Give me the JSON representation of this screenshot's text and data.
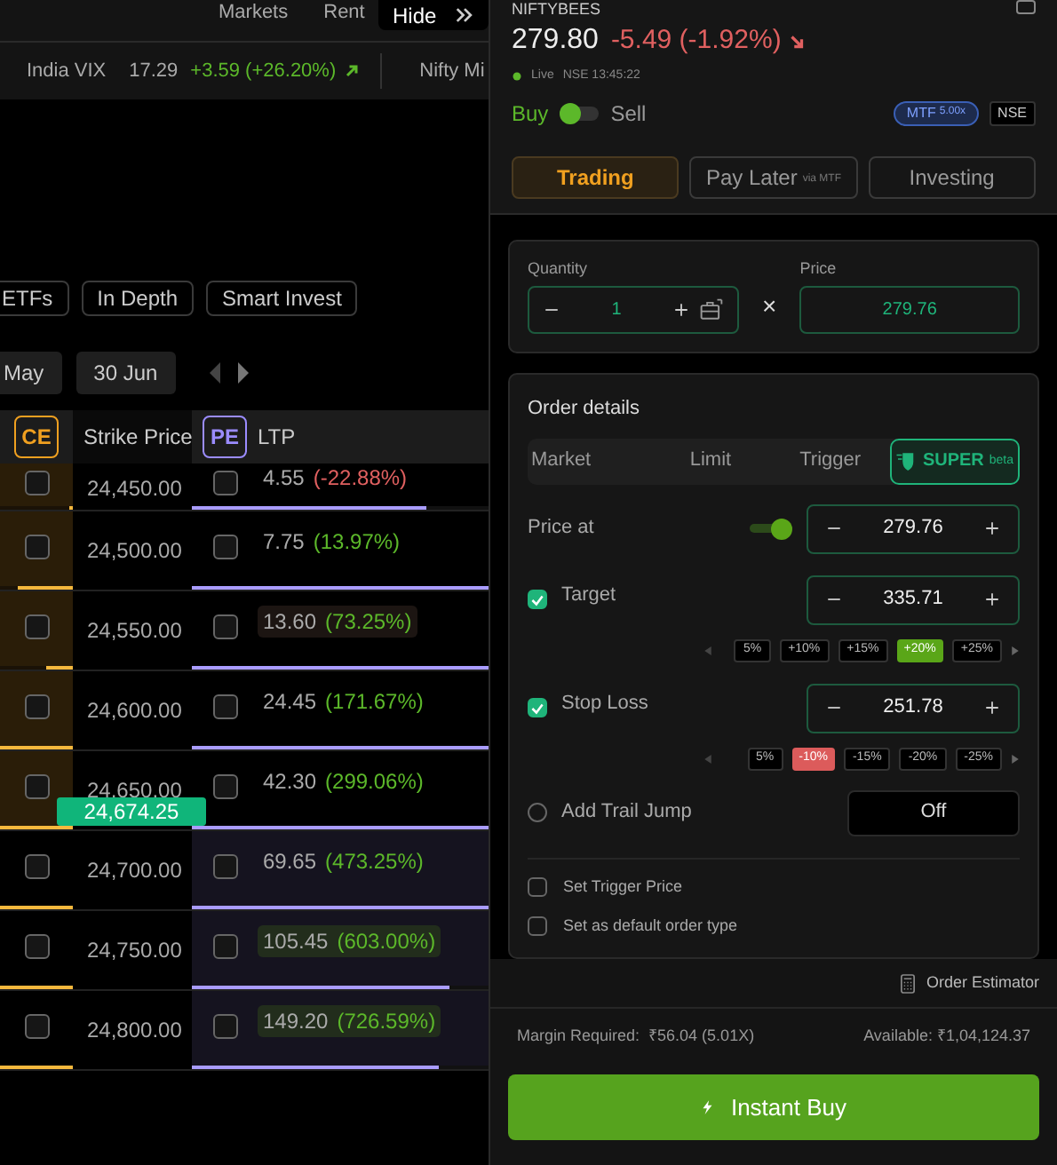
{
  "top_nav": {
    "items": [
      "Markets",
      "Rent"
    ]
  },
  "hide_button": {
    "label": "Hide"
  },
  "ticker": {
    "name": "India VIX",
    "value": "17.29",
    "change": "+3.59 (+26.20%)",
    "negative": false,
    "next": "Nifty Mi"
  },
  "chips": [
    "ETFs",
    "In Depth",
    "Smart Invest"
  ],
  "expiries": [
    "May",
    "30 Jun"
  ],
  "chain": {
    "columns": [
      "CE",
      "Strike Price",
      "PE",
      "LTP"
    ],
    "rows": [
      {
        "kind": "strike",
        "strike": "24,450.00",
        "ltp": "4.55",
        "change": "(-22.88%)",
        "negative": true,
        "ce_itm": true,
        "pe_itm": false,
        "ce_checked": false,
        "pe_checked": false,
        "ce_oi": {
          "level": 0.05
        },
        "pe_oi": {
          "level": 0.79
        }
      },
      {
        "kind": "strike",
        "strike": "24,500.00",
        "ltp": "7.75",
        "change": "(13.97%)",
        "negative": false,
        "ce_itm": true,
        "pe_itm": false,
        "ce_checked": false,
        "pe_checked": false,
        "ce_oi": {
          "level": 0.75
        },
        "pe_oi": {
          "level": 1
        }
      },
      {
        "kind": "strike",
        "strike": "24,550.00",
        "ltp": "13.60",
        "change": "(73.25%)",
        "negative": false,
        "ce_itm": true,
        "pe_itm": false,
        "ce_checked": false,
        "pe_checked": false,
        "highlight": {
          "color": "#1c1512"
        },
        "ce_oi": {
          "level": 0.37
        },
        "pe_oi": {
          "level": 1
        }
      },
      {
        "kind": "strike",
        "strike": "24,600.00",
        "ltp": "24.45",
        "change": "(171.67%)",
        "negative": false,
        "ce_itm": true,
        "pe_itm": false,
        "ce_checked": false,
        "pe_checked": false,
        "ce_oi": {
          "level": 1
        },
        "pe_oi": {
          "level": 1
        }
      },
      {
        "kind": "strike",
        "strike": "24,650.00",
        "ltp": "42.30",
        "change": "(299.06%)",
        "negative": false,
        "ce_itm": true,
        "pe_itm": false,
        "ce_checked": false,
        "pe_checked": false,
        "ce_oi": {
          "level": 1
        },
        "pe_oi": {
          "level": 1
        }
      },
      {
        "kind": "spot",
        "value": "24,674.25"
      },
      {
        "kind": "strike",
        "strike": "24,700.00",
        "ltp": "69.65",
        "change": "(473.25%)",
        "negative": false,
        "ce_itm": false,
        "pe_itm": true,
        "ce_checked": false,
        "pe_checked": false,
        "ce_oi": {
          "level": 1
        },
        "pe_oi": {
          "level": 1
        }
      },
      {
        "kind": "strike",
        "strike": "24,750.00",
        "ltp": "105.45",
        "change": "(603.00%)",
        "negative": false,
        "ce_itm": false,
        "pe_itm": true,
        "ce_checked": false,
        "pe_checked": false,
        "highlight": {
          "color": "#222d1c"
        },
        "ce_oi": {
          "level": 1
        },
        "pe_oi": {
          "level": 0.87
        }
      },
      {
        "kind": "strike",
        "strike": "24,800.00",
        "ltp": "149.20",
        "change": "(726.59%)",
        "negative": false,
        "ce_itm": false,
        "pe_itm": true,
        "ce_checked": false,
        "pe_checked": false,
        "highlight": {
          "color": "#222d1c"
        },
        "ce_oi": {
          "level": 1
        },
        "pe_oi": {
          "level": 0.83
        }
      }
    ]
  },
  "instrument": {
    "symbol": "NIFTYBEES",
    "price": "279.80",
    "change": "-5.49 (-1.92%)",
    "negative": true,
    "status": "Live",
    "exchange_time": "NSE 13:45:22"
  },
  "side": {
    "buy": "Buy",
    "sell": "Sell",
    "sell_selected": false
  },
  "badges": {
    "mtf": "MTF",
    "mtf_value": "5.00x",
    "exchange": "NSE"
  },
  "product_tabs": [
    {
      "label": "Trading",
      "selected": true
    },
    {
      "label": "Pay Later",
      "note": "via MTF",
      "selected": false
    },
    {
      "label": "Investing",
      "selected": false
    }
  ],
  "quantity": {
    "label": "Quantity",
    "value": "1"
  },
  "multiply": "×",
  "price": {
    "label": "Price",
    "value": "279.76"
  },
  "order": {
    "title": "Order details",
    "types": [
      {
        "label": "Market",
        "selected": false
      },
      {
        "label": "Limit",
        "selected": false
      },
      {
        "label": "Trigger",
        "selected": false
      },
      {
        "label": "SUPER",
        "note": "beta",
        "selected": true
      }
    ],
    "price_at": {
      "label": "Price at",
      "on": true,
      "value": "279.76"
    },
    "target": {
      "label": "Target",
      "checked": true,
      "value": "335.71",
      "presets": [
        {
          "label": "5%",
          "selected": false
        },
        {
          "label": "+10%",
          "selected": false
        },
        {
          "label": "+15%",
          "selected": false
        },
        {
          "label": "+20%",
          "selected": true
        },
        {
          "label": "+25%",
          "selected": false
        }
      ]
    },
    "stop_loss": {
      "label": "Stop Loss",
      "checked": true,
      "value": "251.78",
      "presets": [
        {
          "label": "5%",
          "selected": false
        },
        {
          "label": "-10%",
          "selected": true
        },
        {
          "label": "-15%",
          "selected": false
        },
        {
          "label": "-20%",
          "selected": false
        },
        {
          "label": "-25%",
          "selected": false
        }
      ]
    },
    "trail_jump": {
      "label": "Add Trail Jump",
      "checked": false,
      "value": "Off"
    },
    "options": [
      {
        "label": "Set Trigger Price",
        "checked": false
      },
      {
        "label": "Set as default order type",
        "checked": false
      }
    ]
  },
  "footer": {
    "estimator": "Order Estimator",
    "margin": "Margin Required:  ₹56.04 (5.01X)",
    "available": "Available: ₹1,04,124.37",
    "action": "Instant Buy"
  }
}
